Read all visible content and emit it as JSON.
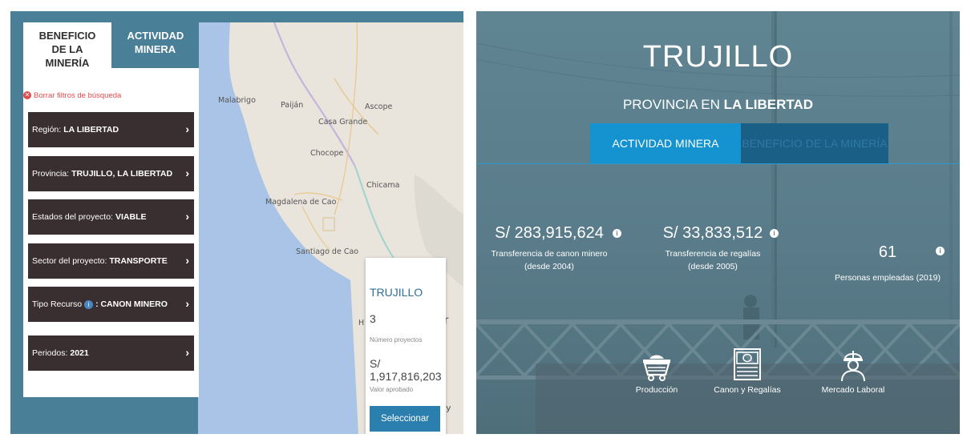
{
  "left_panel": {
    "tabs": [
      {
        "label": "BENEFICIO DE LA MINERÍA"
      },
      {
        "label": "ACTIVIDAD MINERA"
      }
    ],
    "clear_filters": "Borrar filtros de búsqueda",
    "filters": [
      {
        "label": "Región:",
        "value": "LA LIBERTAD"
      },
      {
        "label": "Provincia:",
        "value": "TRUJILLO, LA LIBERTAD"
      },
      {
        "label": "Estados del proyecto:",
        "value": "VIABLE"
      },
      {
        "label": "Sector del proyecto:",
        "value": "TRANSPORTE"
      },
      {
        "label": "Tipo Recurso",
        "value": ": CANON MINERO"
      },
      {
        "label": "Periodos:",
        "value": "2021"
      }
    ],
    "map_labels": {
      "malabrigo": "Malabrigo",
      "paijan": "Paiján",
      "ascope": "Ascope",
      "casa_grande": "Casa Grande",
      "chocope": "Chocope",
      "chicama": "Chicama",
      "magdalena": "Magdalena de Cao",
      "santiago": "Santiago de Cao",
      "h": "H",
      "r": "r",
      "y": "y"
    },
    "popup": {
      "title": "TRUJILLO",
      "count": "3",
      "count_label": "Número proyectos",
      "amount": "S/ 1,917,816,203",
      "amount_label": "Valor aprobado",
      "button": "Seleccionar"
    }
  },
  "right_panel": {
    "title": "TRUJILLO",
    "subtitle_prefix": "PROVINCIA EN",
    "subtitle_bold": "LA LIBERTAD",
    "tabs": [
      {
        "label": "ACTIVIDAD MINERA"
      },
      {
        "label": "BENEFICIO DE LA MINERÍA"
      }
    ],
    "stats": [
      {
        "value": "S/ 283,915,624",
        "desc1": "Transferencia de canon minero",
        "desc2": "(desde 2004)"
      },
      {
        "value": "S/ 33,833,512",
        "desc1": "Transferencia de regalías",
        "desc2": "(desde 2005)"
      },
      {
        "value": "61",
        "desc1": "Personas empleadas (2019)",
        "desc2": ""
      }
    ],
    "info_glyph": "i",
    "bottom_items": [
      {
        "label": "Producción",
        "icon": "mine-cart-icon"
      },
      {
        "label": "Canon y Regalías",
        "icon": "money-bill-icon"
      },
      {
        "label": "Mercado Laboral",
        "icon": "worker-icon"
      }
    ]
  },
  "colors": {
    "panel_blue": "#4a7f98",
    "filter_dark": "#3a2f30",
    "accent_blue": "#1593d1",
    "dark_blue": "#1a5f86",
    "danger": "#e24a4a"
  }
}
